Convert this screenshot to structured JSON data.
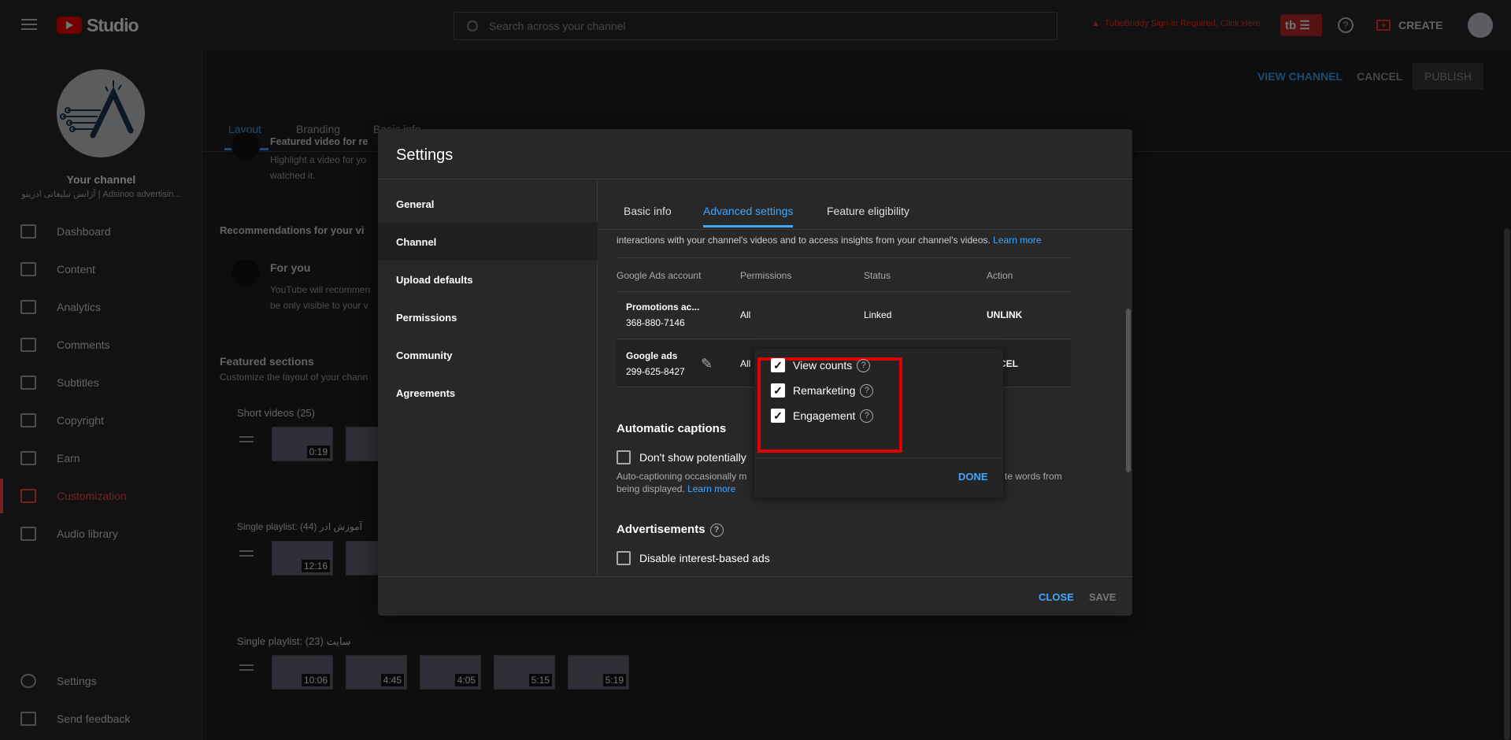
{
  "topbar": {
    "logo": "Studio",
    "search_placeholder": "Search across your channel",
    "warning": "TubeBuddy Sign-in Required, Click Here",
    "tubebuddy": "tb",
    "create": "CREATE"
  },
  "sidebar": {
    "channel_title": "Your channel",
    "channel_name": "آژانس تبلیغاتی ادزینو | Adsinoo advertisin...",
    "items": [
      {
        "label": "Dashboard",
        "icon": "dashboard-icon"
      },
      {
        "label": "Content",
        "icon": "content-icon"
      },
      {
        "label": "Analytics",
        "icon": "analytics-icon"
      },
      {
        "label": "Comments",
        "icon": "comments-icon"
      },
      {
        "label": "Subtitles",
        "icon": "subtitles-icon"
      },
      {
        "label": "Copyright",
        "icon": "copyright-icon"
      },
      {
        "label": "Earn",
        "icon": "earn-icon"
      },
      {
        "label": "Customization",
        "icon": "customization-icon",
        "active": true
      },
      {
        "label": "Audio library",
        "icon": "audio-library-icon"
      }
    ],
    "settings": "Settings",
    "feedback": "Send feedback"
  },
  "page": {
    "tabs": [
      "Layout",
      "Branding",
      "Basic info"
    ],
    "view_channel": "VIEW CHANNEL",
    "cancel": "CANCEL",
    "publish": "PUBLISH",
    "featured_video_title": "Featured video for re",
    "featured_video_desc1": "Highlight a video for yo",
    "featured_video_desc2": "watched it.",
    "recommendations": "Recommendations for your vi",
    "for_you": "For you",
    "for_you_desc1": "YouTube will recommen",
    "for_you_desc2": "be only visible to your v",
    "featured_sections": "Featured sections",
    "featured_sections_desc": "Customize the layout of your chann",
    "sections": [
      {
        "title": "Short videos (25)",
        "durations": [
          "0:19",
          ""
        ]
      },
      {
        "title": "Single playlist: (44) آموزش ادر",
        "durations": [
          "12:16",
          ""
        ]
      },
      {
        "title": "Single playlist: (23) سایت",
        "durations": [
          "10:06",
          "4:45",
          "4:05",
          "5:15",
          "5:19"
        ]
      }
    ]
  },
  "modal": {
    "title": "Settings",
    "nav": [
      "General",
      "Channel",
      "Upload defaults",
      "Permissions",
      "Community",
      "Agreements"
    ],
    "active_nav": "Channel",
    "tabs": [
      "Basic info",
      "Advanced settings",
      "Feature eligibility"
    ],
    "active_tab": "Advanced settings",
    "intro": "interactions with your channel's videos and to access insights from your channel's videos.",
    "learn_more": "Learn more",
    "table": {
      "headers": [
        "Google Ads account",
        "Permissions",
        "Status",
        "Action"
      ],
      "rows": [
        {
          "name": "Promotions ac...",
          "id": "368-880-7146",
          "permissions": "All",
          "status": "Linked",
          "action": "UNLINK"
        },
        {
          "name": "Google ads",
          "id": "299-625-8427",
          "permissions": "All",
          "status": "",
          "action": "CANCEL"
        }
      ]
    },
    "captions_title": "Automatic captions",
    "captions_label": "Don't show potentially",
    "captions_desc1": "Auto-captioning occasionally m",
    "captions_desc1b": "te words from",
    "captions_desc2": "being displayed.",
    "captions_checked": false,
    "ads_title": "Advertisements",
    "ads_label": "Disable interest-based ads",
    "ads_checked": false,
    "close": "CLOSE",
    "save": "SAVE"
  },
  "popup": {
    "options": [
      {
        "label": "View counts",
        "checked": true
      },
      {
        "label": "Remarketing",
        "checked": true
      },
      {
        "label": "Engagement",
        "checked": true
      }
    ],
    "done": "DONE",
    "highlight_color": "#e00000"
  },
  "colors": {
    "accent": "#3ea6ff",
    "brand": "#ff0000",
    "active": "#ff4e45"
  }
}
